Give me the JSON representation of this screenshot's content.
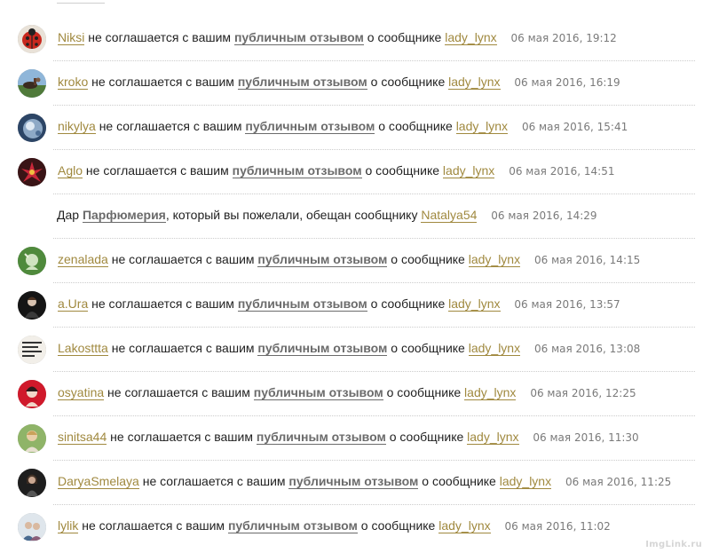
{
  "watermark": "ImgLink.ru",
  "colors": {
    "user_link": "#a0893f",
    "review_link": "#6b6b6b",
    "timestamp": "#7a7a7a"
  },
  "phrases": {
    "disagrees": "не соглашается с вашим",
    "review": "публичным отзывом",
    "about": "о сообщнике"
  },
  "notifications": [
    {
      "user": "Niksi",
      "target": "lady_lynx",
      "time": "06 мая 2016, 19:12"
    },
    {
      "user": "kroko",
      "target": "lady_lynx",
      "time": "06 мая 2016, 16:19"
    },
    {
      "user": "nikylya",
      "target": "lady_lynx",
      "time": "06 мая 2016, 15:41"
    },
    {
      "user": "Aglo",
      "target": "lady_lynx",
      "time": "06 мая 2016, 14:51"
    },
    {
      "user": "zenalada",
      "target": "lady_lynx",
      "time": "06 мая 2016, 14:15"
    },
    {
      "user": "a.Ura",
      "target": "lady_lynx",
      "time": "06 мая 2016, 13:57"
    },
    {
      "user": "Lakosttta",
      "target": "lady_lynx",
      "time": "06 мая 2016, 13:08"
    },
    {
      "user": "osyatina",
      "target": "lady_lynx",
      "time": "06 мая 2016, 12:25"
    },
    {
      "user": "sinitsa44",
      "target": "lady_lynx",
      "time": "06 мая 2016, 11:30"
    },
    {
      "user": "DaryaSmelaya",
      "target": "lady_lynx",
      "time": "06 мая 2016, 11:25"
    },
    {
      "user": "lylik",
      "target": "lady_lynx",
      "time": "06 мая 2016, 11:02"
    }
  ],
  "gift": {
    "prefix": "Дар",
    "name": "Парфюмерия",
    "middle": ", который вы пожелали, обещан сообщнику",
    "recipient": "Natalya54",
    "time": "06 мая 2016, 14:29"
  }
}
